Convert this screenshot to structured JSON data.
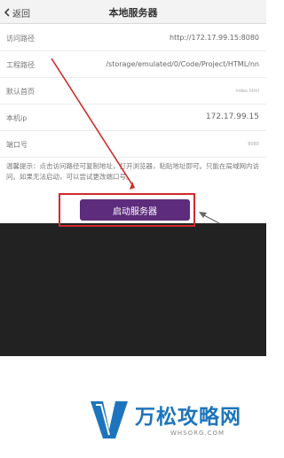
{
  "header": {
    "back_label": "返回",
    "title": "本地服务器"
  },
  "fields": [
    {
      "label": "访问路径",
      "value": "http://172.17.99.15:8080"
    },
    {
      "label": "工程路径",
      "value": "/storage/emulated/0/Code/Project/HTML/nn"
    },
    {
      "label": "默认首页",
      "value": "index.html"
    },
    {
      "label": "本机ip",
      "value": "172.17.99.15"
    },
    {
      "label": "端口号",
      "value": "8080"
    }
  ],
  "tip": "温馨提示：点击访问路径可复制地址，打开浏览器，粘贴地址即可。只能在局域网内访问。如果无法启动，可以尝试更改端口号。",
  "start_button_label": "启动服务器",
  "watermark": {
    "brand": "万松攻略网",
    "domain": "WHSORG.COM"
  },
  "colors": {
    "accent": "#5e2c7c",
    "annotation": "#d12a2a",
    "watermark": "#1c75bc"
  }
}
